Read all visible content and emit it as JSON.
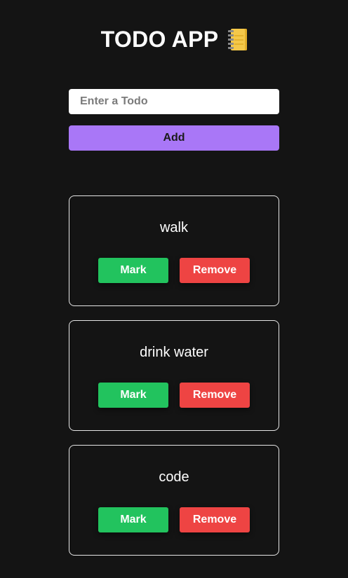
{
  "header": {
    "title": "TODO APP",
    "icon": "notebook-icon"
  },
  "form": {
    "input_placeholder": "Enter a Todo",
    "input_value": "",
    "add_label": "Add"
  },
  "todos": [
    {
      "text": "walk",
      "mark_label": "Mark",
      "remove_label": "Remove"
    },
    {
      "text": "drink water",
      "mark_label": "Mark",
      "remove_label": "Remove"
    },
    {
      "text": "code",
      "mark_label": "Mark",
      "remove_label": "Remove"
    }
  ],
  "colors": {
    "background": "#141414",
    "add_button": "#a977f7",
    "mark_button": "#22c35e",
    "remove_button": "#ee4443",
    "card_border": "#e6e6e6"
  }
}
